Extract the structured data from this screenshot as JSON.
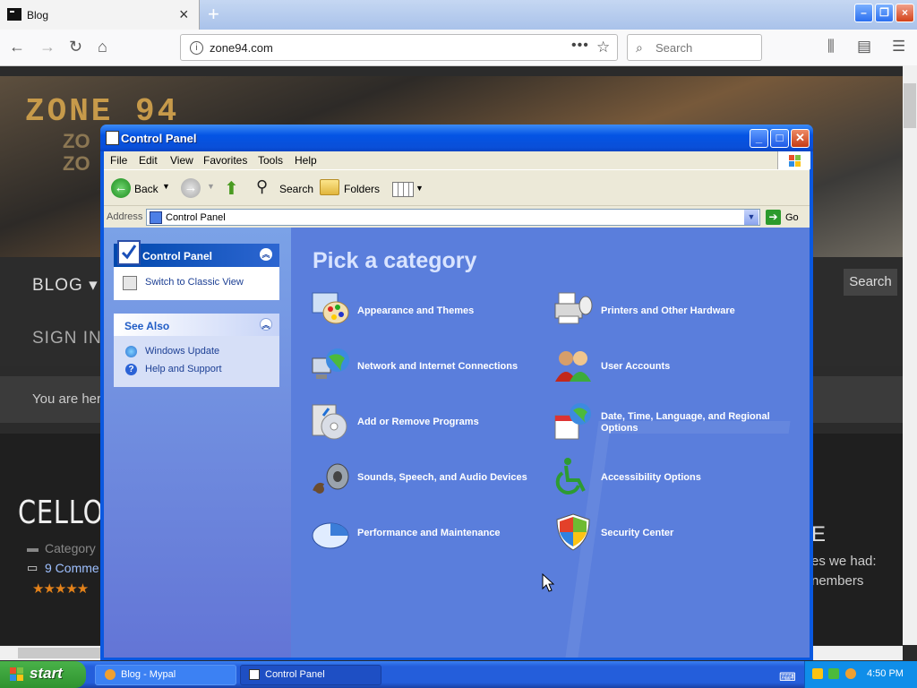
{
  "browser": {
    "tab_title": "Blog",
    "tab_close": "×",
    "new_tab": "+",
    "url": "zone94.com",
    "url_actions_glyph": "•••",
    "search_placeholder": "Search",
    "window_buttons": {
      "minimize": "–",
      "maximize": "❐",
      "close": "×"
    }
  },
  "website": {
    "logo_line1": "ZONE 94",
    "logo_line2": "ZO",
    "logo_line3": "ZO",
    "menu_blog": "BLOG ▾",
    "menu_signin": "SIGN IN",
    "search_button": "Search",
    "breadcrumb_prefix": "You are her",
    "post_title": "CELLO",
    "category": "Category",
    "comments": "9 Comme",
    "stars": "★★★★★",
    "right_heading": "E",
    "right_text_1": "es we had:",
    "right_text_2": "nembers"
  },
  "window": {
    "title": "Control Panel",
    "buttons": {
      "minimize": "_",
      "maximize": "□",
      "close": "✕"
    },
    "menu": [
      "File",
      "Edit",
      "View",
      "Favorites",
      "Tools",
      "Help"
    ],
    "toolbar": {
      "back": "Back",
      "search": "Search",
      "folders": "Folders"
    },
    "address_label": "Address",
    "address_value": "Control Panel",
    "go": "Go"
  },
  "left_pane": {
    "cp_header": "Control Panel",
    "switch_view": "Switch to Classic View",
    "see_also_header": "See Also",
    "see_also": [
      "Windows Update",
      "Help and Support"
    ]
  },
  "main": {
    "heading": "Pick a category",
    "categories": [
      {
        "label": "Appearance and Themes",
        "icon": "appearance-themes-icon"
      },
      {
        "label": "Printers and Other Hardware",
        "icon": "printer-icon"
      },
      {
        "label": "Network and Internet Connections",
        "icon": "network-icon"
      },
      {
        "label": "User Accounts",
        "icon": "user-accounts-icon"
      },
      {
        "label": "Add or Remove Programs",
        "icon": "add-remove-programs-icon"
      },
      {
        "label": "Date, Time, Language, and Regional Options",
        "icon": "date-time-icon"
      },
      {
        "label": "Sounds, Speech, and Audio Devices",
        "icon": "sound-icon"
      },
      {
        "label": "Accessibility Options",
        "icon": "accessibility-icon"
      },
      {
        "label": "Performance and Maintenance",
        "icon": "performance-icon"
      },
      {
        "label": "Security Center",
        "icon": "security-shield-icon"
      }
    ]
  },
  "taskbar": {
    "start": "start",
    "tasks": [
      "Blog - Mypal",
      "Control Panel"
    ],
    "clock": "4:50 PM"
  }
}
